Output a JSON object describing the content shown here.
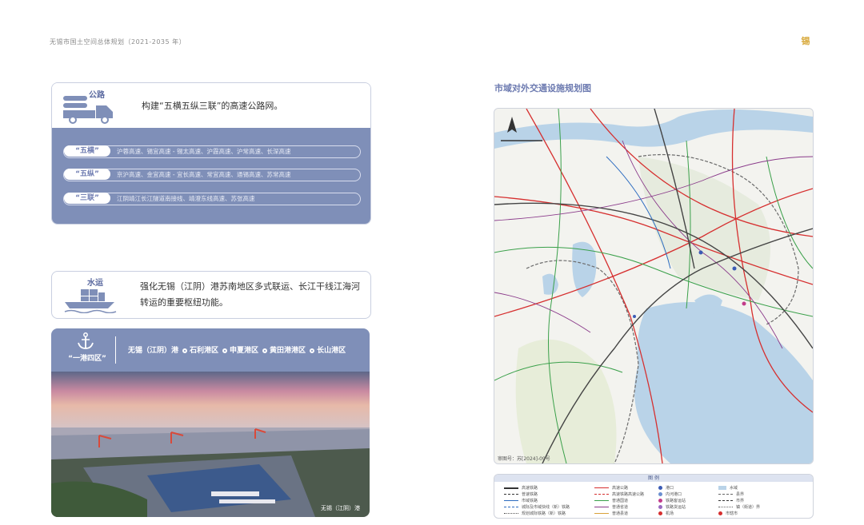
{
  "header": {
    "title": "无锡市国土空间总体规划（2021-2035 年）",
    "logo_text": "锡"
  },
  "road": {
    "label": "公路",
    "description": "构建“五横五纵三联”的高速公路网。",
    "rows": [
      {
        "tag": "“五横”",
        "text": "沪蓉高速、锡宜高速 - 锡太高速、沪霞高速、沪常高速、长深高速"
      },
      {
        "tag": "“五纵”",
        "text": "京沪高速、金宜高速 - 宜长高速、常宜高速、通锡高速、苏常高速"
      },
      {
        "tag": "“三联”",
        "text": "江阴靖江长江隧道南接线、靖澄东线高速、苏张高速"
      }
    ]
  },
  "water": {
    "label": "水运",
    "description": "强化无锡（江阴）港苏南地区多式联运、长江干线江海河转运的重要枢纽功能。"
  },
  "port": {
    "title": "“一港四区”",
    "main": "无锡（江阴）港",
    "areas": [
      "石利港区",
      "申夏港区",
      "黄田港港区",
      "长山港区"
    ],
    "photo_caption": "无锡（江阴）港"
  },
  "map": {
    "title": "市域对外交通设施规划图",
    "note": "审图号：苏[2024]-09号",
    "legend_title": "图 例",
    "legend": [
      "高速铁路",
      "普速铁路",
      "市域铁路",
      "城际及市域快线（新）铁路",
      "规划城际铁路（新）铁路",
      "高速公路",
      "高速铁路高速公路",
      "普通国道",
      "普通省道",
      "普通县道",
      "港口",
      "内河港口",
      "铁路客运站",
      "铁路货运站",
      "机场",
      "水域",
      "县界",
      "市界",
      "镇（街道）界",
      "市辖市"
    ],
    "colors": {
      "river": "#b9d3e8",
      "lake": "#b9d3e8",
      "rail": "#555555",
      "highway": "#d62f2f",
      "national": "#3aa04a",
      "provincial": "#8a3a8a"
    }
  },
  "colors": {
    "accent": "#7f8fb8",
    "accent_dark": "#5b6aa0",
    "brand": "#d8a93a"
  }
}
